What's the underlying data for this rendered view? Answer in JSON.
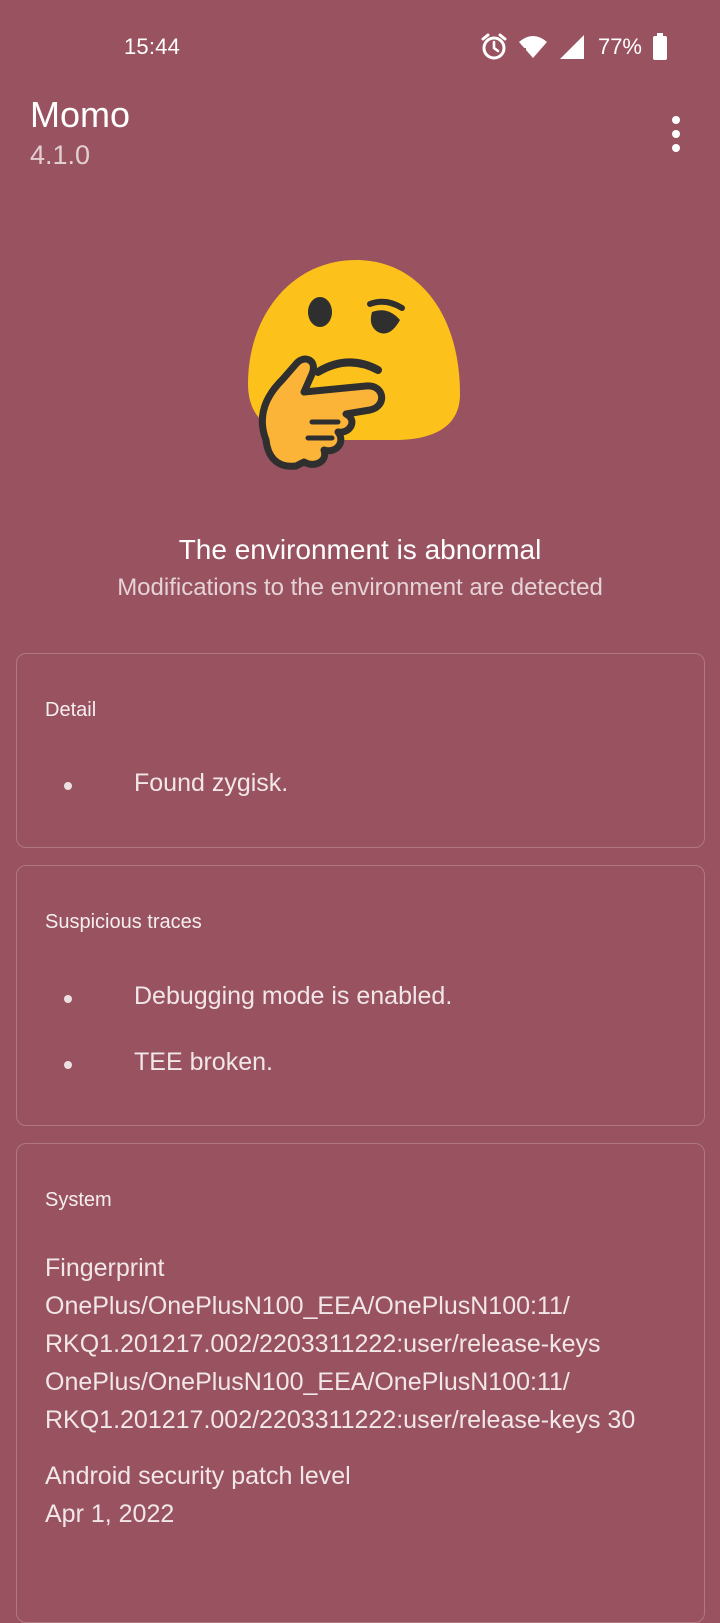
{
  "status_bar": {
    "time": "15:44",
    "battery": "77%",
    "icons": [
      "alarm-icon",
      "wifi-icon",
      "signal-icon",
      "battery-icon"
    ]
  },
  "app": {
    "title": "Momo",
    "version": "4.1.0",
    "menu_icon": "more-vert-icon"
  },
  "result": {
    "icon": "thinking-face-emoji",
    "title": "The environment is abnormal",
    "subtitle": "Modifications to the environment are detected"
  },
  "detail": {
    "title": "Detail",
    "items": [
      "Found zygisk."
    ]
  },
  "suspicious": {
    "title": "Suspicious traces",
    "items": [
      "Debugging mode is enabled.",
      "TEE broken."
    ]
  },
  "system": {
    "title": "System",
    "fingerprint_label": "Fingerprint",
    "fingerprint_lines": [
      "OnePlus/OnePlusN100_EEA/OnePlusN100:11/",
      "RKQ1.201217.002/2203311222:user/release-keys",
      "OnePlus/OnePlusN100_EEA/OnePlusN100:11/",
      "RKQ1.201217.002/2203311222:user/release-keys 30"
    ],
    "patch_label": "Android security patch level",
    "patch_value": "Apr 1, 2022"
  },
  "colors": {
    "background": "#99525F",
    "emoji_face": "#FCC21B",
    "emoji_outline": "#2F2F2F"
  }
}
